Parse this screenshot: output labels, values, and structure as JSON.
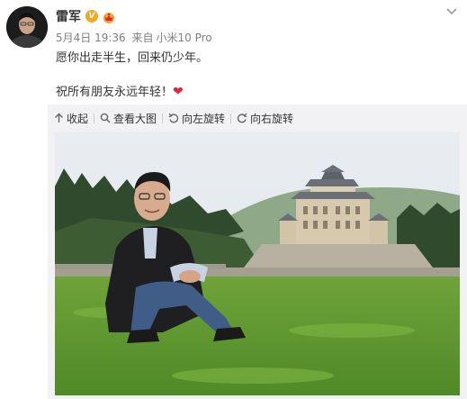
{
  "post": {
    "user": {
      "name": "雷军",
      "verified_badge": "V",
      "member_badge_icon": "crown-icon"
    },
    "meta": {
      "date": "5月4日 19:36",
      "source_prefix": "来自",
      "device": "小米10 Pro"
    },
    "text": {
      "line1": "愿你出走半生，回来仍少年。",
      "line2": "祝所有朋友永远年轻！",
      "emoji": "❤"
    },
    "toolbar": {
      "collapse": "收起",
      "view_large": "查看大图",
      "rotate_left": "向左旋转",
      "rotate_right": "向右旋转"
    },
    "colors": {
      "badge_orange": "#f5a623",
      "heart_red": "#e0243a",
      "meta_gray": "#808080",
      "media_bg": "#f2f2f5"
    },
    "icons": [
      "chevron-down-icon",
      "arrow-up-icon",
      "search-icon",
      "rotate-left-icon",
      "rotate-right-icon"
    ]
  }
}
